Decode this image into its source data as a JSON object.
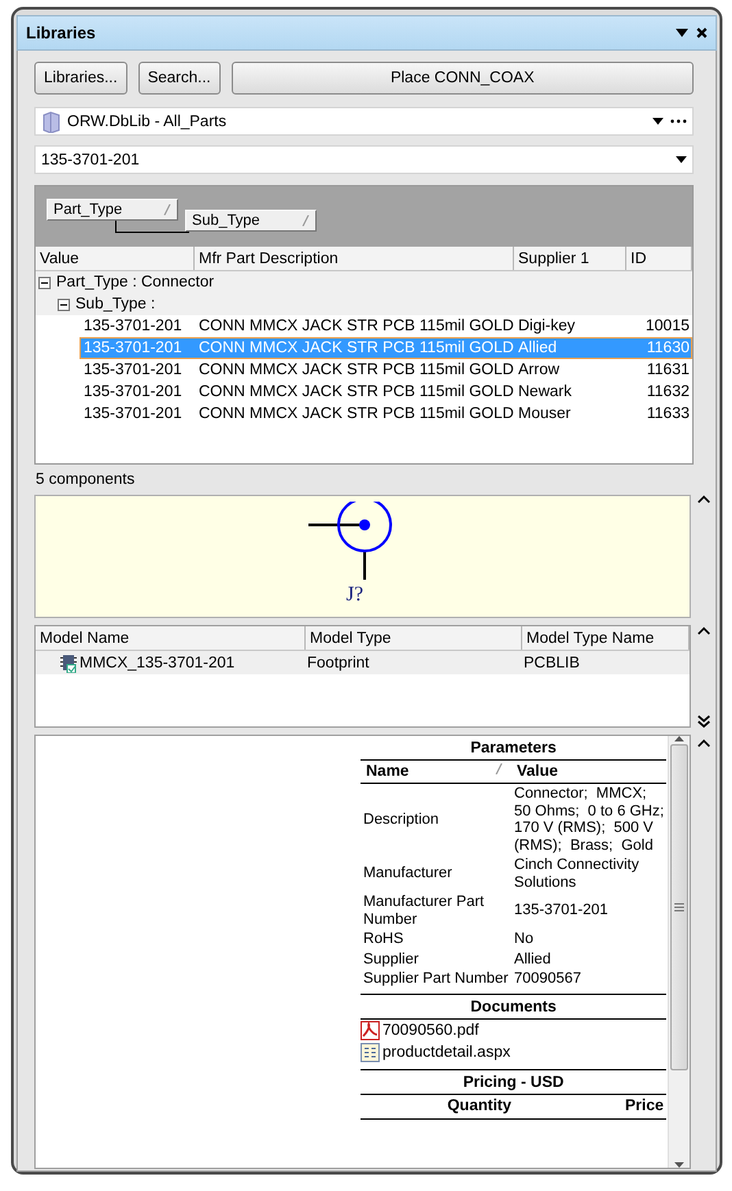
{
  "window": {
    "title": "Libraries"
  },
  "buttons": [
    {
      "label": "Libraries..."
    },
    {
      "label": "Search..."
    },
    {
      "label": "Place CONN_COAX"
    }
  ],
  "library": {
    "value": "ORW.DbLib - All_Parts"
  },
  "search": {
    "value": "135-3701-201"
  },
  "group_by": [
    {
      "label": "Part_Type"
    },
    {
      "label": "Sub_Type"
    }
  ],
  "table": {
    "columns": [
      "Value",
      "Mfr Part Description",
      "Supplier 1",
      "ID"
    ],
    "groups": [
      {
        "label": "Part_Type : Connector",
        "expanded": true,
        "children": [
          {
            "label": "Sub_Type :",
            "expanded": true,
            "rows": [
              {
                "value": "135-3701-201",
                "description": "CONN MMCX JACK STR PCB 115mil GOLD",
                "supplier": "Digi-key",
                "id": "10015",
                "selected": false
              },
              {
                "value": "135-3701-201",
                "description": "CONN MMCX JACK STR PCB 115mil GOLD",
                "supplier": "Allied",
                "id": "11630",
                "selected": true
              },
              {
                "value": "135-3701-201",
                "description": "CONN MMCX JACK STR PCB 115mil GOLD",
                "supplier": "Arrow",
                "id": "11631",
                "selected": false
              },
              {
                "value": "135-3701-201",
                "description": "CONN MMCX JACK STR PCB 115mil GOLD",
                "supplier": "Newark",
                "id": "11632",
                "selected": false
              },
              {
                "value": "135-3701-201",
                "description": "CONN MMCX JACK STR PCB 115mil GOLD",
                "supplier": "Mouser",
                "id": "11633",
                "selected": false
              }
            ]
          }
        ]
      }
    ]
  },
  "status": "5 components",
  "preview": {
    "designator": "J?"
  },
  "models": {
    "columns": [
      "Model Name",
      "Model Type",
      "Model Type Name"
    ],
    "rows": [
      {
        "name": "MMCX_135-3701-201",
        "type": "Footprint",
        "type_name": "PCBLIB"
      }
    ]
  },
  "parameters": {
    "title": "Parameters",
    "columns": [
      "Name",
      "Value"
    ],
    "rows": [
      {
        "name": "Description",
        "value": "Connector;  MMCX;  50 Ohms;  0 to 6 GHz;  170 V (RMS);  500 V (RMS);  Brass;  Gold"
      },
      {
        "name": "Manufacturer",
        "value": "Cinch Connectivity Solutions"
      },
      {
        "name": "Manufacturer Part Number",
        "value": "135-3701-201"
      },
      {
        "name": "RoHS",
        "value": "No"
      },
      {
        "name": "Supplier",
        "value": "Allied"
      },
      {
        "name": "Supplier Part Number",
        "value": "70090567"
      }
    ]
  },
  "documents": {
    "title": "Documents",
    "items": [
      {
        "kind": "pdf",
        "name": "70090560.pdf"
      },
      {
        "kind": "page",
        "name": "productdetail.aspx"
      }
    ]
  },
  "pricing": {
    "title": "Pricing - USD",
    "columns": [
      "Quantity",
      "Price"
    ]
  }
}
